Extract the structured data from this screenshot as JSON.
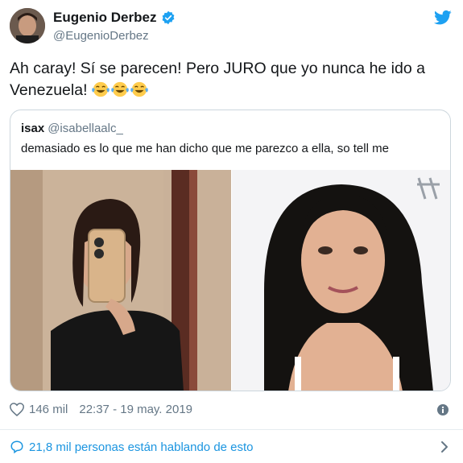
{
  "tweet": {
    "author_name": "Eugenio Derbez",
    "author_handle": "@EugenioDerbez",
    "text": "Ah caray! Sí se parecen! Pero JURO que yo nunca he ido a Venezuela!",
    "emoji": "face-with-tears-of-joy"
  },
  "quoted": {
    "name": "isax",
    "handle": "@isabellaalc_",
    "text": "demasiado es lo que me han dicho que me parezco a ella, so tell me"
  },
  "footer": {
    "likes": "146 mil",
    "timestamp": "22:37 - 19 may. 2019"
  },
  "conversation": {
    "label": "21,8 mil personas están hablando de esto"
  },
  "colors": {
    "twitter_blue": "#1da1f2",
    "link_blue": "#1b95e0",
    "secondary_text": "#657786"
  },
  "icons": {
    "verified": "verified-badge-icon",
    "bird": "twitter-bird-icon",
    "heart": "heart-icon",
    "info": "info-icon",
    "chat": "chat-bubble-icon",
    "chevron": "chevron-right-icon"
  }
}
